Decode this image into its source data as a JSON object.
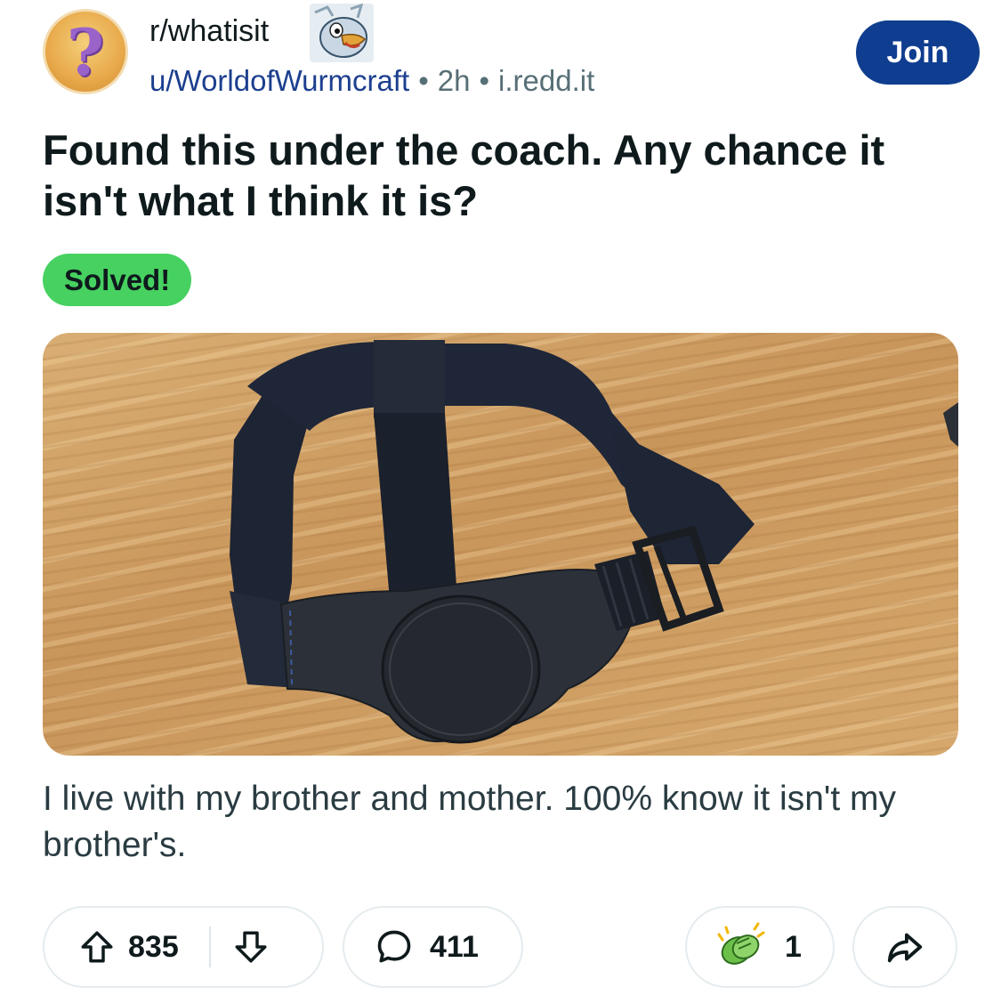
{
  "header": {
    "subreddit": "r/whatisit",
    "username": "u/WorldofWurmcraft",
    "time": "2h",
    "domain": "i.redd.it",
    "join_label": "Join",
    "avatar_glyph": "?"
  },
  "post": {
    "title": "Found this under the coach. Any chance it isn't what I think it is?",
    "flair": "Solved!",
    "flair_color": "#46d160",
    "body": "I live with my brother and mother. 100% know it isn't my brother's."
  },
  "actions": {
    "upvotes": "835",
    "comments": "411",
    "awards": "1",
    "upvote_icon": "upvote-arrow-icon",
    "downvote_icon": "downvote-arrow-icon",
    "comment_icon": "comment-bubble-icon",
    "award_icon": "clapping-hands-award-icon",
    "share_icon": "share-arrow-icon"
  },
  "colors": {
    "join_button": "#0f3d8f",
    "username": "#1c3f8f",
    "meta_text": "#576f76"
  }
}
